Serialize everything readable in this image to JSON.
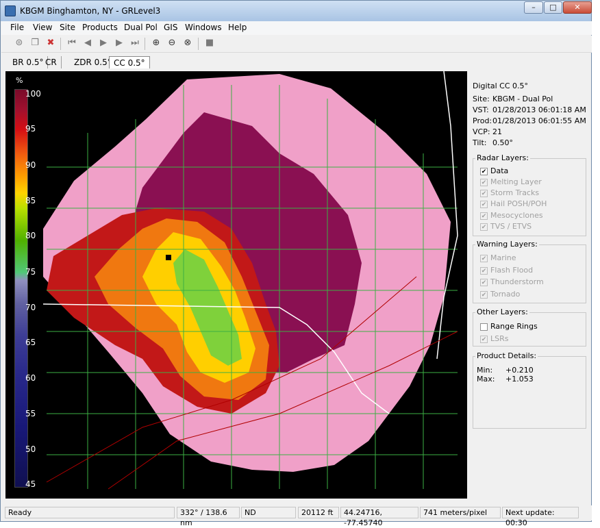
{
  "window": {
    "title": "KBGM Binghamton, NY - GRLevel3",
    "controls": {
      "min": "–",
      "max": "□",
      "close": "✕"
    }
  },
  "menu": [
    "File",
    "View",
    "Site",
    "Products",
    "Dual Pol",
    "GIS",
    "Windows",
    "Help"
  ],
  "toolbar": [
    "save-icon",
    "copy-icon",
    "delete-icon",
    "first-frame-icon",
    "prev-frame-icon",
    "play-icon",
    "next-frame-icon",
    "last-frame-icon",
    "zoom-in-icon",
    "zoom-out-icon",
    "zoom-reset-icon",
    "stop-icon"
  ],
  "tabs": [
    {
      "label": "BR 0.5°"
    },
    {
      "label": "CR"
    },
    {
      "label": "ZDR 0.5°"
    },
    {
      "label": "CC 0.5°",
      "active": true
    }
  ],
  "scale": {
    "unit": "%",
    "ticks": [
      "100",
      "95",
      "90",
      "85",
      "80",
      "75",
      "70",
      "65",
      "60",
      "55",
      "50",
      "45"
    ]
  },
  "info": {
    "product": "Digital CC 0.5°",
    "site": "KBGM - Dual Pol",
    "vst": "01/28/2013  06:01:18 AM",
    "prod": "01/28/2013  06:01:55 AM",
    "vcp": "21",
    "tilt": "0.50°",
    "labels": {
      "site": "Site:",
      "vst": "VST:",
      "prod": "Prod:",
      "vcp": "VCP:",
      "tilt": "Tilt:"
    }
  },
  "radar_layers": {
    "title": "Radar Layers:",
    "items": [
      {
        "label": "Data",
        "checked": true,
        "enabled": true
      },
      {
        "label": "Melting Layer",
        "checked": true,
        "enabled": false
      },
      {
        "label": "Storm Tracks",
        "checked": true,
        "enabled": false
      },
      {
        "label": "Hail POSH/POH",
        "checked": true,
        "enabled": false
      },
      {
        "label": "Mesocyclones",
        "checked": true,
        "enabled": false
      },
      {
        "label": "TVS / ETVS",
        "checked": true,
        "enabled": false
      }
    ]
  },
  "warning_layers": {
    "title": "Warning Layers:",
    "items": [
      {
        "label": "Marine",
        "checked": true,
        "enabled": false
      },
      {
        "label": "Flash Flood",
        "checked": true,
        "enabled": false
      },
      {
        "label": "Thunderstorm",
        "checked": true,
        "enabled": false
      },
      {
        "label": "Tornado",
        "checked": true,
        "enabled": false
      }
    ]
  },
  "other_layers": {
    "title": "Other Layers:",
    "items": [
      {
        "label": "Range Rings",
        "checked": false,
        "enabled": true
      },
      {
        "label": "LSRs",
        "checked": true,
        "enabled": false
      }
    ]
  },
  "product_details": {
    "title": "Product Details:",
    "min_label": "Min:",
    "min": "+0.210",
    "max_label": "Max:",
    "max": "+1.053"
  },
  "status": {
    "ready": "Ready",
    "azimuth": "332° / 138.6 nm",
    "value": "ND",
    "height": "20112 ft",
    "coords": "44.24716, -77.45740",
    "resolution": "741 meters/pixel",
    "next_update": "Next update: 00:30"
  },
  "colors": {
    "background": "#000000",
    "county_lines": "#3cb043",
    "state_lines": "#ffffff",
    "roads": "#b00000"
  }
}
